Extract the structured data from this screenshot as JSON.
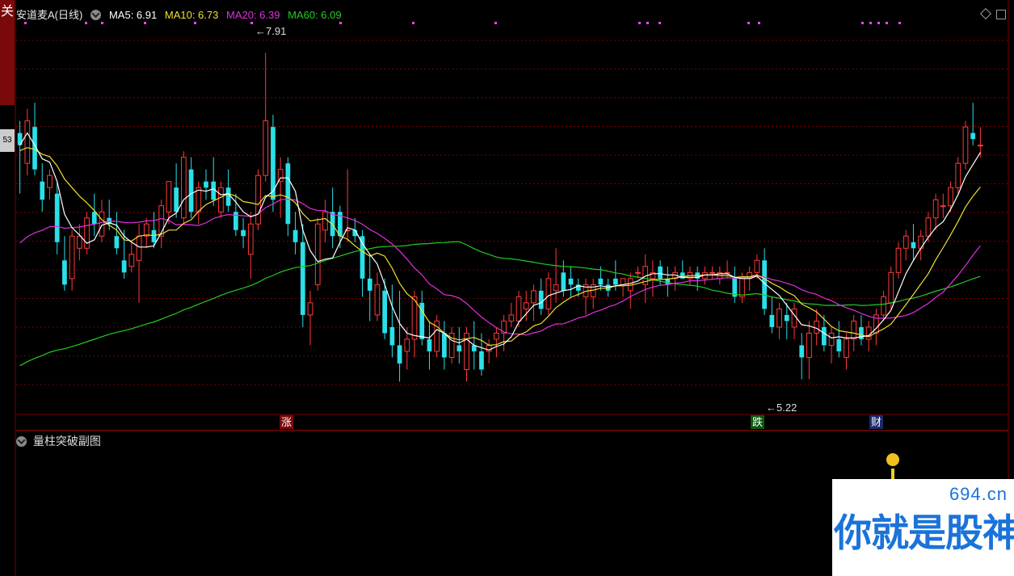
{
  "header": {
    "title": "安道麦A(日线)",
    "ma5_label": "MA5: 6.91",
    "ma10_label": "MA10: 6.73",
    "ma20_label": "MA20: 6.39",
    "ma60_label": "MA60: 6.09"
  },
  "side": {
    "tab_top": "关",
    "tab_mid": "53"
  },
  "annotations": {
    "high": "7.91",
    "low": "5.22"
  },
  "badges": {
    "rise": "涨",
    "fall": "跌",
    "fin": "财"
  },
  "sub_panel": {
    "title": "量柱突破副图"
  },
  "watermark": {
    "url": "694.cn",
    "text": "你就是股神"
  },
  "colors": {
    "up": "#ff3a3a",
    "down": "#29e0e8",
    "ma5": "#ffffff",
    "ma10": "#f0e030",
    "ma20": "#e030e0",
    "ma60": "#22cc22",
    "grid": "#7a0000",
    "marker": "#ff44ff"
  },
  "chart_data": {
    "type": "candlestick",
    "price_range": [
      5.0,
      8.2
    ],
    "candles": [
      [
        7.25,
        7.35,
        6.75,
        7.15
      ],
      [
        7.0,
        7.45,
        6.9,
        7.35
      ],
      [
        7.3,
        7.5,
        6.9,
        6.95
      ],
      [
        6.85,
        7.0,
        6.6,
        6.7
      ],
      [
        6.8,
        6.95,
        6.7,
        6.9
      ],
      [
        6.75,
        6.85,
        6.25,
        6.35
      ],
      [
        6.2,
        6.4,
        5.95,
        6.0
      ],
      [
        6.05,
        6.45,
        5.95,
        6.4
      ],
      [
        6.3,
        6.5,
        6.2,
        6.4
      ],
      [
        6.3,
        6.6,
        6.25,
        6.55
      ],
      [
        6.6,
        6.75,
        6.4,
        6.5
      ],
      [
        6.4,
        6.7,
        6.35,
        6.6
      ],
      [
        6.55,
        6.7,
        6.45,
        6.5
      ],
      [
        6.4,
        6.6,
        6.25,
        6.3
      ],
      [
        6.2,
        6.45,
        6.05,
        6.1
      ],
      [
        6.15,
        6.35,
        6.1,
        6.25
      ],
      [
        6.2,
        6.5,
        5.85,
        6.4
      ],
      [
        6.4,
        6.55,
        6.3,
        6.5
      ],
      [
        6.45,
        6.6,
        6.3,
        6.35
      ],
      [
        6.4,
        6.7,
        6.3,
        6.65
      ],
      [
        6.6,
        6.85,
        6.5,
        6.85
      ],
      [
        6.8,
        7.0,
        6.55,
        6.6
      ],
      [
        6.55,
        7.1,
        6.5,
        7.05
      ],
      [
        6.95,
        7.05,
        6.55,
        6.6
      ],
      [
        6.6,
        6.85,
        6.5,
        6.8
      ],
      [
        6.85,
        6.95,
        6.7,
        6.8
      ],
      [
        6.85,
        7.05,
        6.65,
        6.7
      ],
      [
        6.6,
        6.85,
        6.55,
        6.8
      ],
      [
        6.8,
        6.95,
        6.6,
        6.65
      ],
      [
        6.6,
        6.75,
        6.4,
        6.45
      ],
      [
        6.45,
        6.55,
        6.3,
        6.4
      ],
      [
        6.25,
        6.6,
        6.05,
        6.5
      ],
      [
        6.5,
        6.95,
        6.45,
        6.9
      ],
      [
        6.9,
        7.91,
        6.85,
        7.35
      ],
      [
        7.3,
        7.4,
        6.6,
        6.7
      ],
      [
        6.85,
        7.05,
        6.55,
        6.95
      ],
      [
        7.0,
        7.05,
        6.4,
        6.5
      ],
      [
        6.45,
        6.6,
        6.25,
        6.35
      ],
      [
        6.35,
        6.5,
        5.65,
        5.75
      ],
      [
        5.75,
        5.95,
        5.5,
        5.85
      ],
      [
        6.0,
        6.55,
        5.95,
        6.5
      ],
      [
        6.45,
        6.7,
        6.35,
        6.6
      ],
      [
        6.6,
        6.8,
        6.3,
        6.4
      ],
      [
        6.6,
        6.65,
        6.3,
        6.4
      ],
      [
        6.45,
        6.95,
        6.35,
        6.45
      ],
      [
        6.45,
        6.55,
        6.35,
        6.4
      ],
      [
        6.4,
        6.45,
        5.9,
        6.05
      ],
      [
        6.05,
        6.25,
        5.7,
        5.95
      ],
      [
        5.75,
        6.1,
        5.7,
        6.0
      ],
      [
        5.95,
        6.05,
        5.55,
        5.6
      ],
      [
        5.65,
        6.0,
        5.4,
        5.5
      ],
      [
        5.5,
        5.95,
        5.2,
        5.35
      ],
      [
        5.45,
        5.65,
        5.3,
        5.55
      ],
      [
        5.55,
        5.95,
        5.4,
        5.9
      ],
      [
        5.85,
        5.95,
        5.5,
        5.55
      ],
      [
        5.55,
        5.7,
        5.3,
        5.45
      ],
      [
        5.45,
        5.75,
        5.4,
        5.7
      ],
      [
        5.6,
        5.7,
        5.3,
        5.4
      ],
      [
        5.4,
        5.65,
        5.35,
        5.6
      ],
      [
        5.5,
        5.65,
        5.35,
        5.45
      ],
      [
        5.3,
        5.65,
        5.2,
        5.6
      ],
      [
        5.5,
        5.7,
        5.3,
        5.45
      ],
      [
        5.45,
        5.6,
        5.25,
        5.3
      ],
      [
        5.45,
        5.55,
        5.35,
        5.5
      ],
      [
        5.55,
        5.65,
        5.4,
        5.6
      ],
      [
        5.6,
        5.75,
        5.45,
        5.7
      ],
      [
        5.7,
        5.85,
        5.65,
        5.75
      ],
      [
        5.7,
        5.95,
        5.65,
        5.9
      ],
      [
        5.8,
        5.95,
        5.7,
        5.85
      ],
      [
        5.85,
        6.0,
        5.7,
        5.95
      ],
      [
        5.95,
        6.05,
        5.75,
        5.8
      ],
      [
        5.8,
        6.1,
        5.75,
        6.05
      ],
      [
        5.95,
        6.3,
        5.85,
        6.0
      ],
      [
        6.1,
        6.2,
        5.9,
        5.95
      ],
      [
        6.05,
        6.15,
        5.9,
        6.0
      ],
      [
        6.0,
        6.05,
        5.9,
        5.95
      ],
      [
        5.9,
        6.05,
        5.75,
        6.0
      ],
      [
        5.9,
        6.05,
        5.8,
        6.0
      ],
      [
        6.05,
        6.15,
        5.95,
        6.0
      ],
      [
        6.0,
        6.05,
        5.9,
        5.95
      ],
      [
        6.05,
        6.2,
        5.95,
        6.0
      ],
      [
        6.0,
        6.05,
        5.9,
        6.05
      ],
      [
        5.95,
        6.1,
        5.8,
        6.05
      ],
      [
        6.1,
        6.15,
        6.05,
        6.1
      ],
      [
        6.0,
        6.25,
        5.85,
        6.15
      ],
      [
        6.05,
        6.2,
        5.9,
        6.1
      ],
      [
        6.15,
        6.2,
        6.0,
        6.05
      ],
      [
        6.05,
        6.15,
        5.9,
        6.0
      ],
      [
        6.05,
        6.15,
        5.95,
        6.1
      ],
      [
        6.1,
        6.2,
        6.05,
        6.05
      ],
      [
        6.05,
        6.15,
        6.0,
        6.1
      ],
      [
        6.1,
        6.15,
        5.95,
        6.05
      ],
      [
        6.05,
        6.15,
        6.0,
        6.1
      ],
      [
        6.1,
        6.15,
        6.05,
        6.1
      ],
      [
        6.05,
        6.15,
        6.0,
        6.1
      ],
      [
        6.1,
        6.2,
        6.05,
        6.1
      ],
      [
        6.05,
        6.15,
        5.85,
        5.9
      ],
      [
        5.9,
        6.1,
        5.85,
        6.05
      ],
      [
        6.05,
        6.15,
        5.95,
        6.1
      ],
      [
        6.1,
        6.25,
        6.05,
        6.2
      ],
      [
        6.2,
        6.3,
        5.75,
        5.8
      ],
      [
        5.75,
        5.9,
        5.6,
        5.65
      ],
      [
        5.65,
        5.85,
        5.55,
        5.8
      ],
      [
        5.75,
        5.85,
        5.55,
        5.7
      ],
      [
        5.65,
        5.85,
        5.55,
        5.8
      ],
      [
        5.5,
        5.6,
        5.22,
        5.4
      ],
      [
        5.4,
        5.7,
        5.22,
        5.6
      ],
      [
        5.6,
        5.8,
        5.5,
        5.7
      ],
      [
        5.65,
        5.75,
        5.45,
        5.5
      ],
      [
        5.5,
        5.65,
        5.35,
        5.6
      ],
      [
        5.55,
        5.7,
        5.4,
        5.45
      ],
      [
        5.4,
        5.6,
        5.3,
        5.55
      ],
      [
        5.55,
        5.75,
        5.45,
        5.7
      ],
      [
        5.65,
        5.75,
        5.5,
        5.55
      ],
      [
        5.55,
        5.7,
        5.45,
        5.65
      ],
      [
        5.6,
        5.8,
        5.5,
        5.75
      ],
      [
        5.75,
        5.95,
        5.7,
        5.9
      ],
      [
        5.85,
        6.15,
        5.8,
        6.1
      ],
      [
        6.1,
        6.35,
        6.05,
        6.3
      ],
      [
        6.3,
        6.45,
        6.2,
        6.4
      ],
      [
        6.35,
        6.5,
        6.2,
        6.3
      ],
      [
        6.3,
        6.45,
        6.2,
        6.4
      ],
      [
        6.4,
        6.6,
        6.35,
        6.55
      ],
      [
        6.55,
        6.75,
        6.45,
        6.7
      ],
      [
        6.65,
        6.75,
        6.55,
        6.65
      ],
      [
        6.65,
        6.85,
        6.6,
        6.8
      ],
      [
        6.8,
        7.05,
        6.75,
        7.0
      ],
      [
        7.0,
        7.35,
        6.95,
        7.3
      ],
      [
        7.25,
        7.5,
        7.15,
        7.2
      ],
      [
        7.15,
        7.3,
        7.05,
        7.15
      ]
    ],
    "ma_lines": [
      "MA5",
      "MA10",
      "MA20",
      "MA60"
    ]
  }
}
